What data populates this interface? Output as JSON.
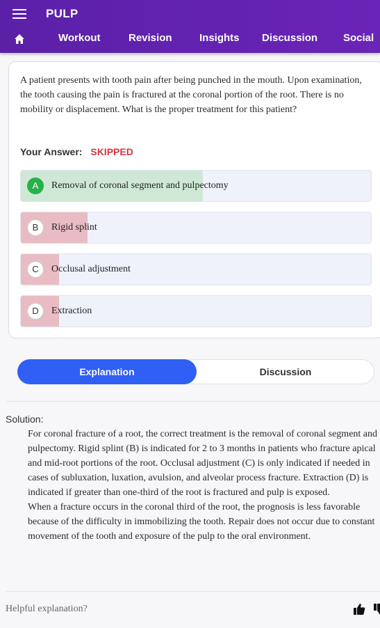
{
  "app": {
    "title": "PULP"
  },
  "nav": {
    "home_icon": "home-icon",
    "items": [
      "Workout",
      "Revision",
      "Insights",
      "Discussion",
      "Social"
    ]
  },
  "question": {
    "text": "A patient presents with tooth pain after being punched in the mouth. Upon examination, the tooth causing the pain is fractured at the coronal portion of the root. There is no mobility or displacement. What is the proper treatment for this patient?",
    "your_answer_label": "Your Answer:",
    "your_answer_value": "SKIPPED",
    "options": [
      {
        "letter": "A",
        "text": "Removal of coronal segment and pulpectomy",
        "correct": true,
        "percent": 52
      },
      {
        "letter": "B",
        "text": "Rigid splint",
        "correct": false,
        "percent": 19
      },
      {
        "letter": "C",
        "text": "Occlusal adjustment",
        "correct": false,
        "percent": 11
      },
      {
        "letter": "D",
        "text": "Extraction",
        "correct": false,
        "percent": 11
      }
    ]
  },
  "tabs": {
    "active": "Explanation",
    "inactive": "Discussion"
  },
  "solution": {
    "heading": "Solution:",
    "para1": "For coronal fracture of a root, the correct treatment is the removal of coronal segment and pulpectomy. Rigid splint (B) is indicated for 2 to 3 months in patients who fracture apical and mid-root portions of the root. Occlusal adjustment (C) is only indicated if needed in cases of subluxation, luxation, avulsion, and alveolar process fracture. Extraction (D) is indicated if greater than one-third of the root is fractured and pulp is exposed.",
    "para2": "When a fracture occurs in the coronal third of the root, the prognosis is less favorable because of the difficulty in immobilizing the tooth. Repair does not occur due to constant movement of the tooth and exposure of the pulp to the oral environment."
  },
  "feedback": {
    "question": "Helpful explanation?"
  },
  "colors": {
    "brand": "#6a24b7",
    "correct_fill": "#cfe8d6",
    "wrong_fill": "#e9bcc4",
    "accent": "#2f5ff5",
    "skipped": "#d2353f"
  }
}
